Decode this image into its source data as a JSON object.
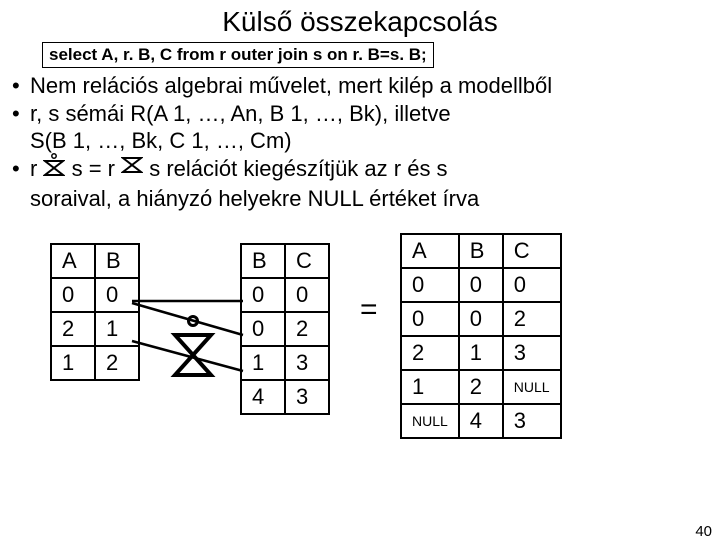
{
  "title": "Külső összekapcsolás",
  "sql": "select A, r. B, C from r outer join s on r. B=s. B;",
  "bullets": {
    "b1": "Nem relációs algebrai művelet, mert kilép a modellből",
    "b2": "r, s sémái R(A 1, …, An, B 1, …, Bk), illetve",
    "b2b": "S(B 1, …, Bk, C 1, …, Cm)",
    "b3a": "r ",
    "b3b": " s = r ",
    "b3c": " s relációt kiegészítjük az r és s",
    "b3d": "soraival, a hiányzó helyekre NULL értéket írva"
  },
  "table1": {
    "h1": "A",
    "h2": "B",
    "r1c1": "0",
    "r1c2": "0",
    "r2c1": "2",
    "r2c2": "1",
    "r3c1": "1",
    "r3c2": "2"
  },
  "table2": {
    "h1": "B",
    "h2": "C",
    "r1c1": "0",
    "r1c2": "0",
    "r2c1": "0",
    "r2c2": "2",
    "r3c1": "1",
    "r3c2": "3",
    "r4c1": "4",
    "r4c2": "3"
  },
  "table3": {
    "h1": "A",
    "h2": "B",
    "h3": "C",
    "r1c1": "0",
    "r1c2": "0",
    "r1c3": "0",
    "r2c1": "0",
    "r2c2": "0",
    "r2c3": "2",
    "r3c1": "2",
    "r3c2": "1",
    "r3c3": "3",
    "r4c1": "1",
    "r4c2": "2",
    "r4c3": "NULL",
    "r5c1": "NULL",
    "r5c2": "4",
    "r5c3": "3"
  },
  "equals": "=",
  "page": "40"
}
